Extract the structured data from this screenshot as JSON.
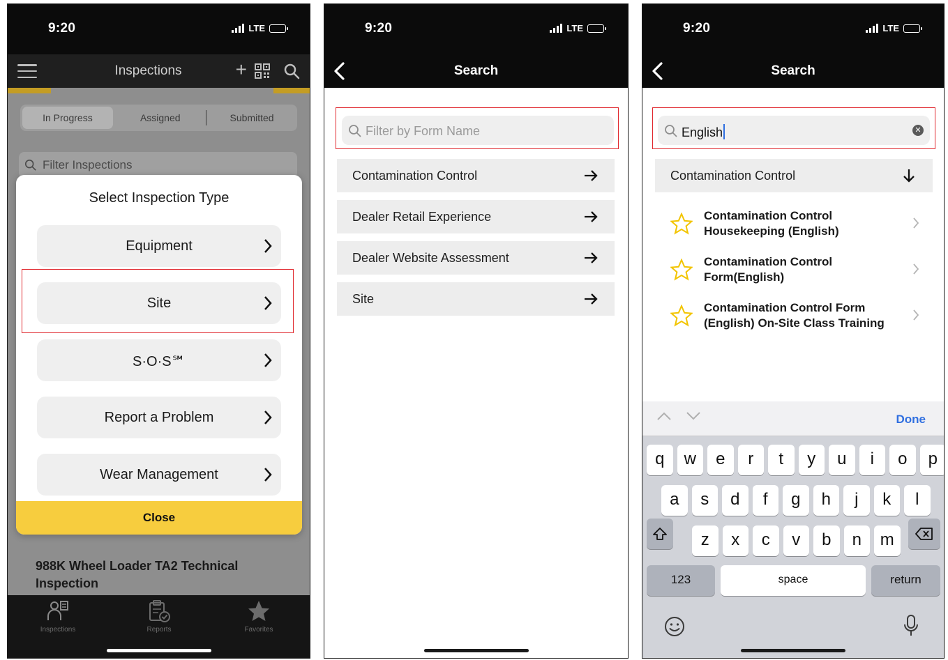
{
  "status": {
    "time": "9:20",
    "network": "LTE"
  },
  "panel1": {
    "nav_title": "Inspections",
    "segments": [
      "In Progress",
      "Assigned",
      "Submitted"
    ],
    "filter_placeholder": "Filter Inspections",
    "bg_card_title": "988K Wheel Loader TA2 Technical Inspection",
    "modal": {
      "title": "Select Inspection Type",
      "options": [
        "Equipment",
        "Site",
        "S·O·S℠",
        "Report a Problem",
        "Wear Management"
      ],
      "close_label": "Close"
    },
    "tabs": [
      "Inspections",
      "Reports",
      "Favorites"
    ]
  },
  "panel2": {
    "nav_title": "Search",
    "search_placeholder": "Filter by Form Name",
    "rows": [
      "Contamination Control",
      "Dealer Retail Experience",
      "Dealer Website Assessment",
      "Site"
    ]
  },
  "panel3": {
    "nav_title": "Search",
    "search_value": "English",
    "group_label": "Contamination Control",
    "results": [
      "Contamination Control Housekeeping (English)",
      "Contamination Control Form(English)",
      "Contamination Control Form (English) On-Site Class Training"
    ],
    "keyboard": {
      "done_label": "Done",
      "row1": [
        "q",
        "w",
        "e",
        "r",
        "t",
        "y",
        "u",
        "i",
        "o",
        "p"
      ],
      "row2": [
        "a",
        "s",
        "d",
        "f",
        "g",
        "h",
        "j",
        "k",
        "l"
      ],
      "row3": [
        "z",
        "x",
        "c",
        "v",
        "b",
        "n",
        "m"
      ],
      "numbers_label": "123",
      "space_label": "space",
      "return_label": "return"
    }
  },
  "colors": {
    "accent_yellow": "#f7cd3e",
    "highlight_red": "#e0282e",
    "link_blue": "#2f6fe0"
  }
}
